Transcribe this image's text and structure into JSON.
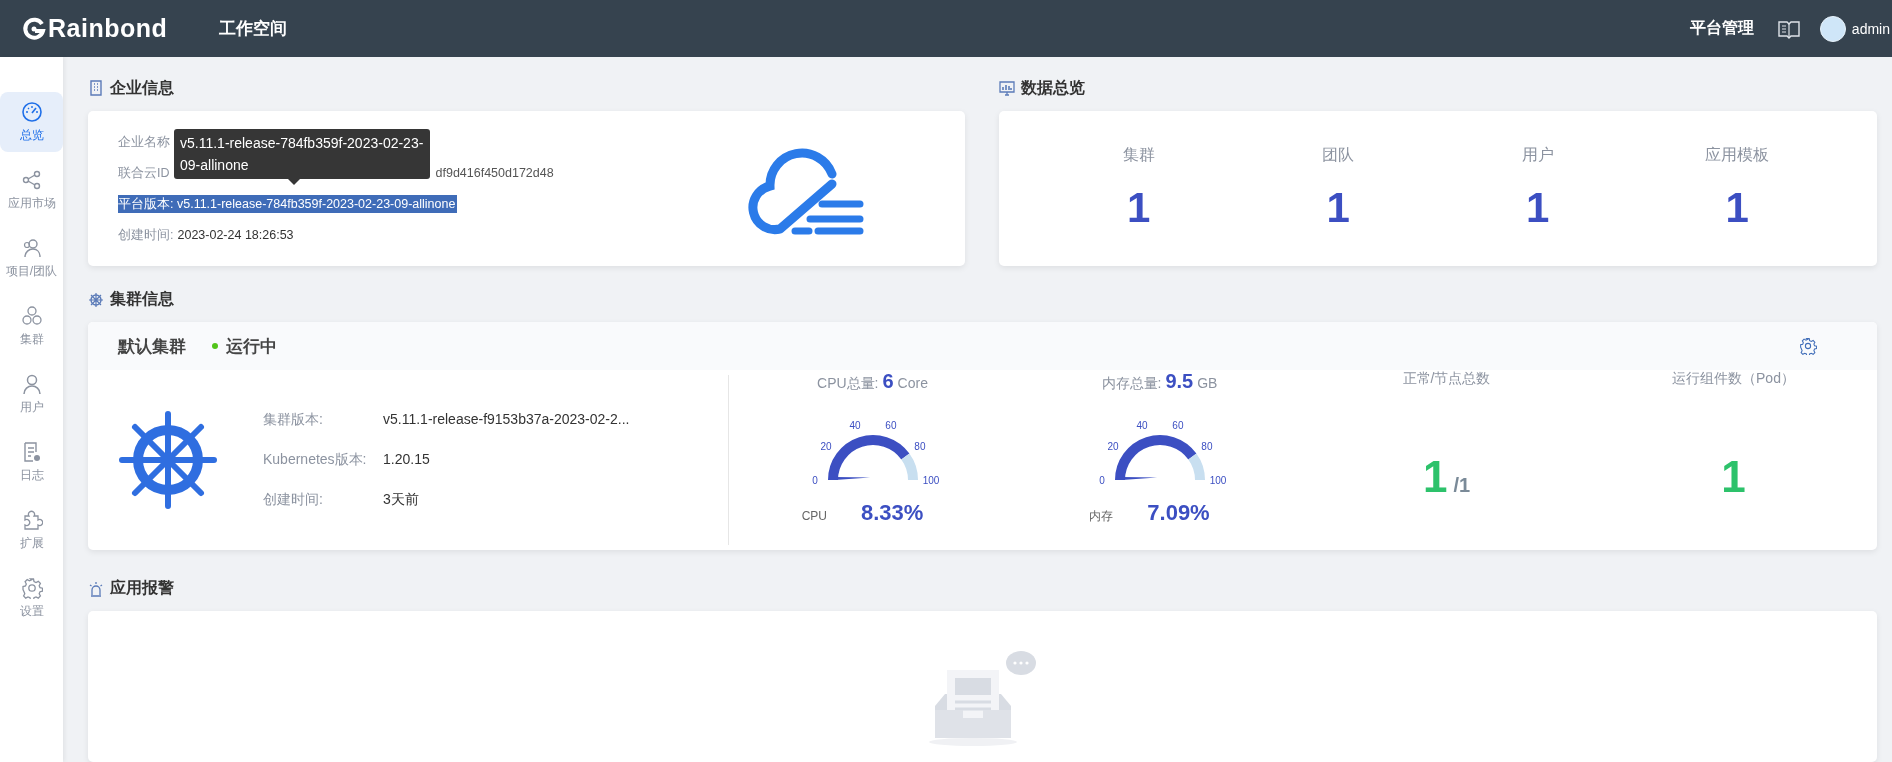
{
  "header": {
    "brand": "Rainbond",
    "workspace": "工作空间",
    "platform_admin": "平台管理",
    "user": "admin"
  },
  "sidebar": {
    "items": [
      {
        "label": "总览",
        "selected": true
      },
      {
        "label": "应用市场",
        "selected": false
      },
      {
        "label": "项目/团队",
        "selected": false
      },
      {
        "label": "集群",
        "selected": false
      },
      {
        "label": "用户",
        "selected": false
      },
      {
        "label": "日志",
        "selected": false
      },
      {
        "label": "扩展",
        "selected": false
      },
      {
        "label": "设置",
        "selected": false
      }
    ]
  },
  "enterprise": {
    "title": "企业信息",
    "rows": [
      {
        "label": "企业名称",
        "selected": false
      },
      {
        "label": "联合云ID",
        "value": "df9d416f450d172d48",
        "selected": false
      },
      {
        "label": "平台版本:",
        "value": "v5.11.1-release-784fb359f-2023-02-23-09-allinone",
        "selected": true
      },
      {
        "label": "创建时间:",
        "value": "2023-02-24 18:26:53",
        "selected": false
      }
    ],
    "tooltip": "v5.11.1-release-784fb359f-2023-02-23-09-allinone"
  },
  "overview": {
    "title": "数据总览",
    "stats": [
      {
        "label": "集群",
        "value": "1"
      },
      {
        "label": "团队",
        "value": "1"
      },
      {
        "label": "用户",
        "value": "1"
      },
      {
        "label": "应用模板",
        "value": "1"
      }
    ]
  },
  "cluster_section": {
    "title": "集群信息",
    "name": "默认集群",
    "status": "运行中",
    "info": [
      {
        "label": "集群版本:",
        "value": "v5.11.1-release-f9153b37a-2023-02-2..."
      },
      {
        "label": "Kubernetes版本:",
        "value": "1.20.15"
      },
      {
        "label": "创建时间:",
        "value": "3天前"
      }
    ],
    "metrics": [
      {
        "kind": "gauge",
        "label": "CPU总量:",
        "amount": "6",
        "unit": "Core",
        "scale": [
          "0",
          "20",
          "40",
          "60",
          "80",
          "100"
        ],
        "gauge_label": "CPU",
        "percent": "8.33%"
      },
      {
        "kind": "gauge",
        "label": "内存总量:",
        "amount": "9.5",
        "unit": "GB",
        "scale": [
          "0",
          "20",
          "40",
          "60",
          "80",
          "100"
        ],
        "gauge_label": "内存",
        "percent": "7.09%"
      },
      {
        "kind": "count",
        "label": "正常/节点总数",
        "value": "1",
        "total": "/1"
      },
      {
        "kind": "count",
        "label": "运行组件数（Pod）",
        "value": "1"
      }
    ]
  },
  "alarms": {
    "title": "应用报警"
  }
}
